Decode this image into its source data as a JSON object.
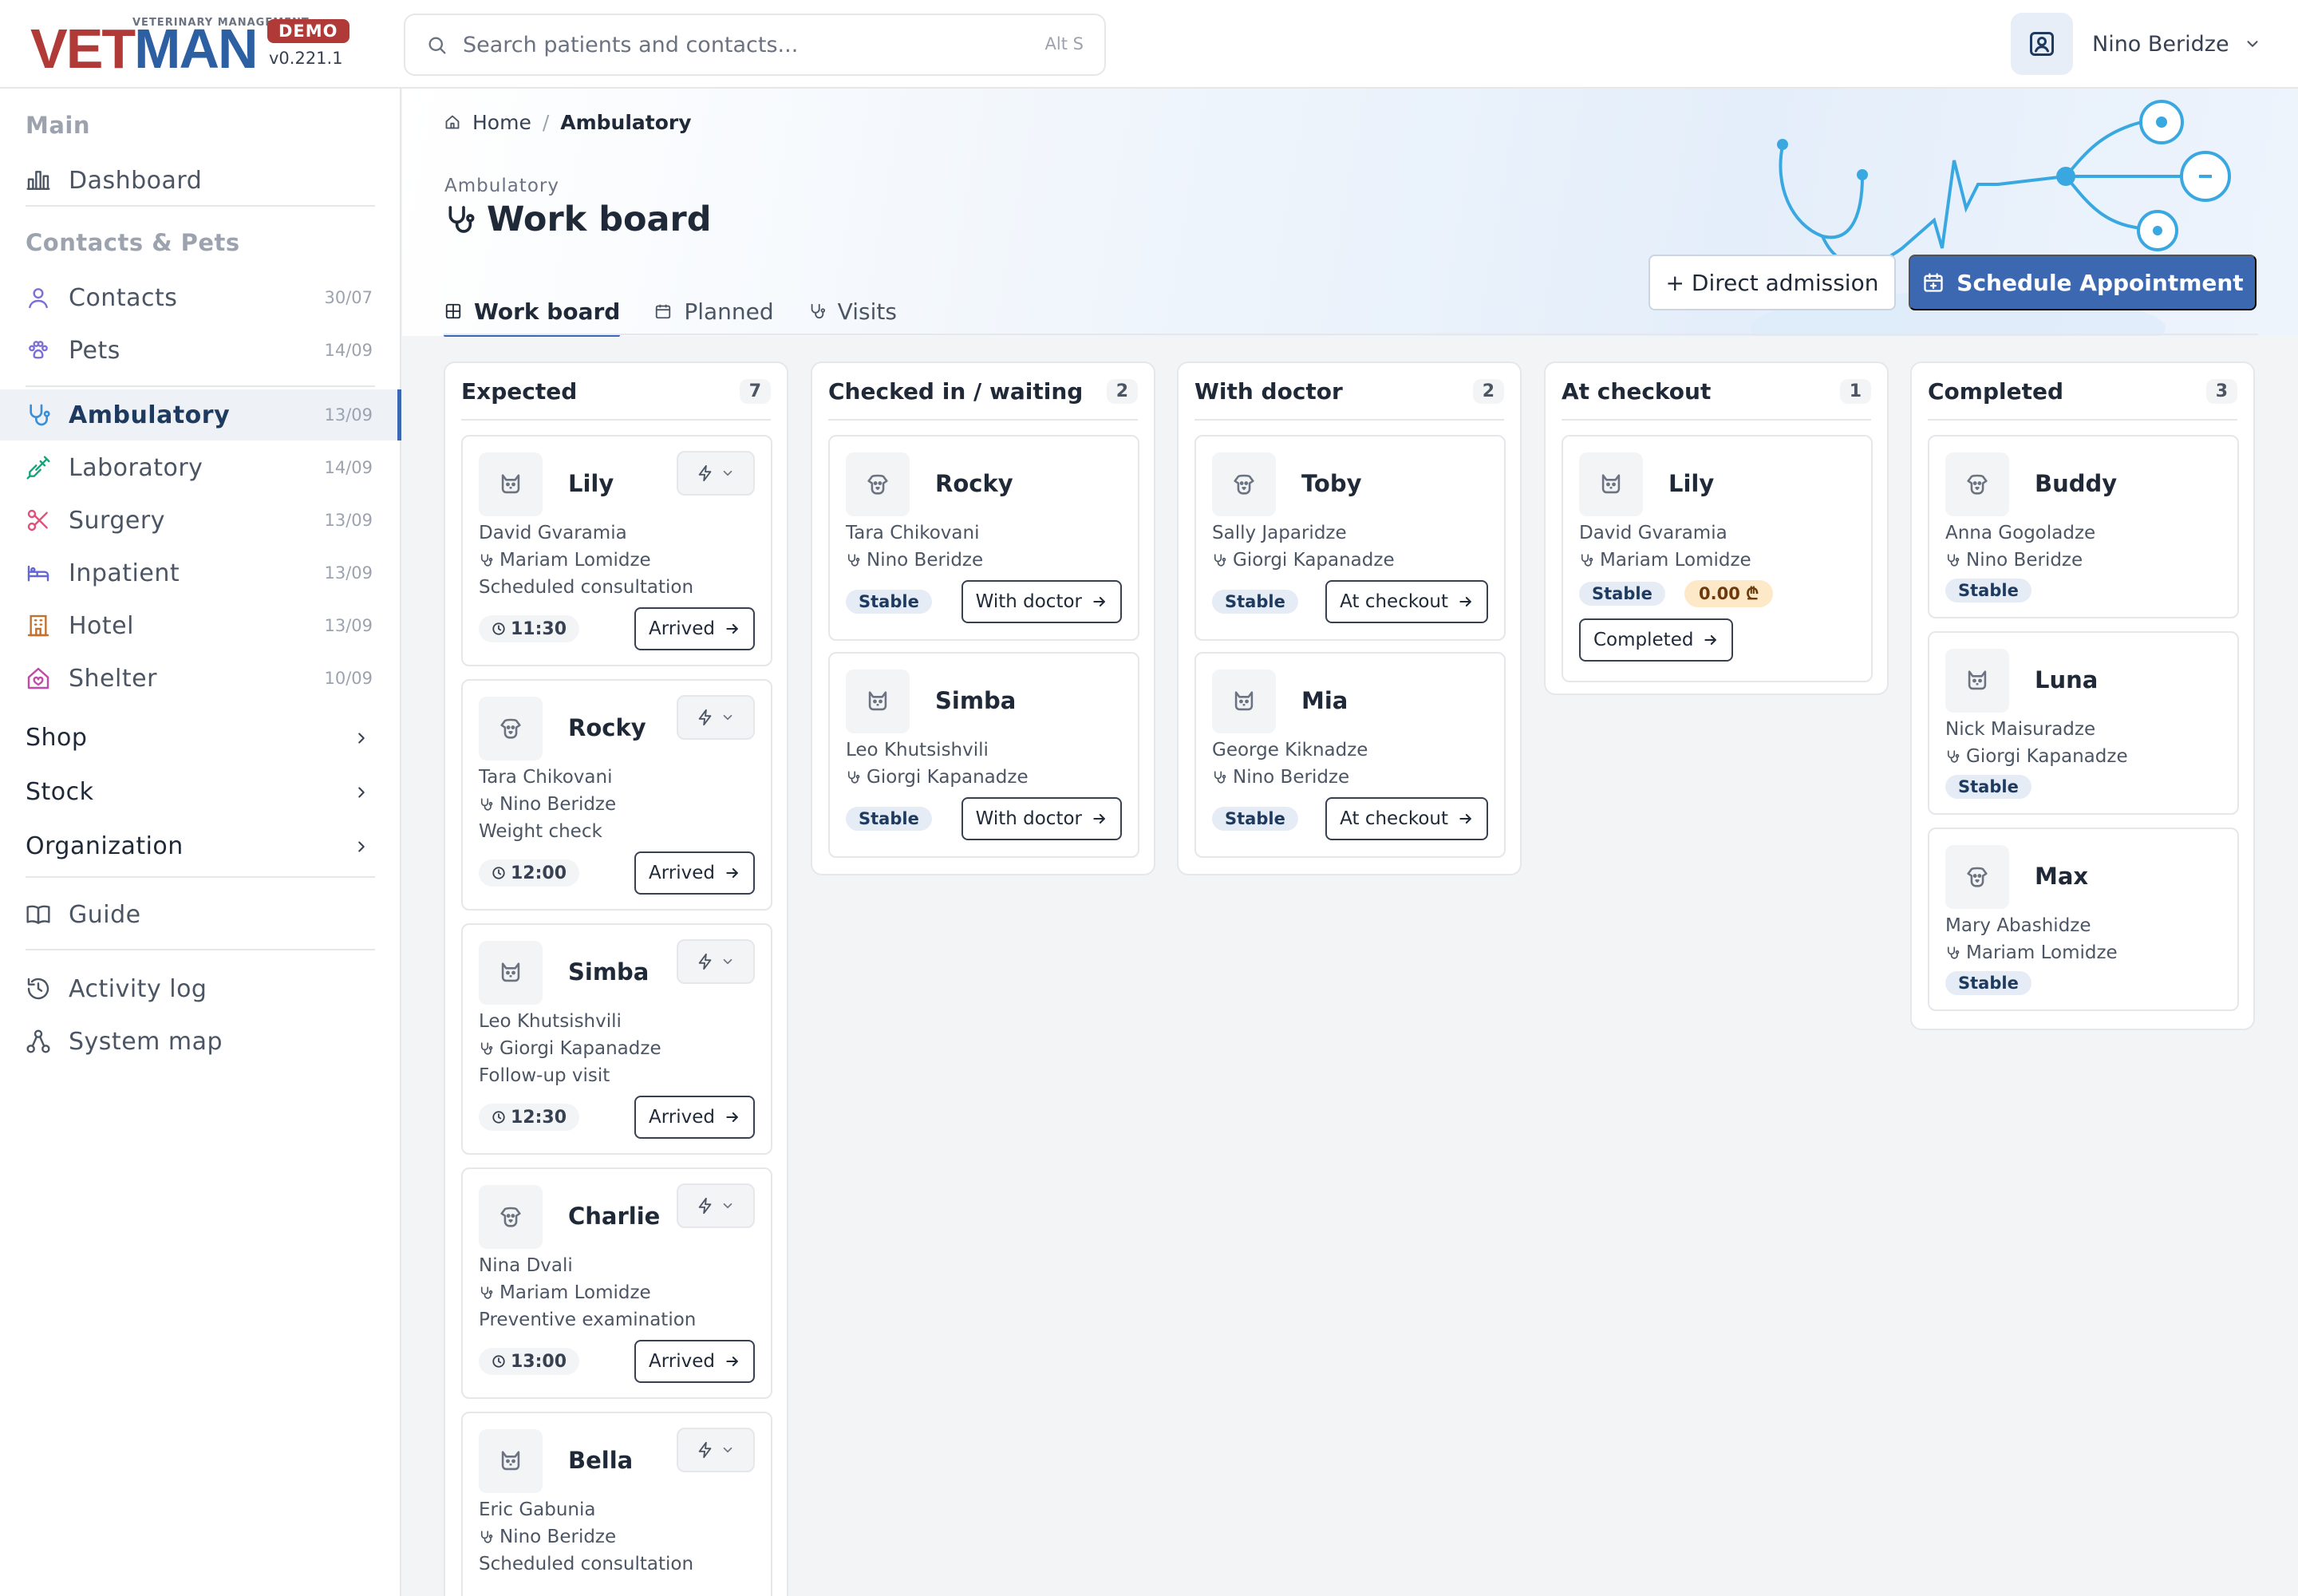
{
  "app": {
    "logo_tagline": "VETERINARY MANAGEMENT",
    "logo_text_1": "VET",
    "logo_text_2": "MAN",
    "badge": "DEMO",
    "version": "v0.221.1",
    "brand_colors": {
      "red": "#b03a37",
      "blue": "#2d5fa3"
    }
  },
  "search": {
    "placeholder": "Search patients and contacts...",
    "shortcut": "Alt S",
    "icon": "search-icon"
  },
  "user": {
    "name": "Nino Beridze",
    "icon": "user-square-icon"
  },
  "sidebar": {
    "sections": {
      "main": "Main",
      "contacts_pets": "Contacts & Pets"
    },
    "items": [
      {
        "label": "Dashboard",
        "icon": "chart-bar-icon",
        "count": ""
      },
      {
        "label": "Contacts",
        "icon": "person-icon",
        "count": "30/07"
      },
      {
        "label": "Pets",
        "icon": "paw-icon",
        "count": "14/09"
      },
      {
        "label": "Ambulatory",
        "icon": "stethoscope-icon",
        "count": "13/09",
        "active": true
      },
      {
        "label": "Laboratory",
        "icon": "syringe-icon",
        "count": "14/09"
      },
      {
        "label": "Surgery",
        "icon": "scissors-icon",
        "count": "13/09"
      },
      {
        "label": "Inpatient",
        "icon": "bed-icon",
        "count": "13/09"
      },
      {
        "label": "Hotel",
        "icon": "building-icon",
        "count": "13/09"
      },
      {
        "label": "Shelter",
        "icon": "house-heart-icon",
        "count": "10/09"
      }
    ],
    "groups": [
      {
        "label": "Shop"
      },
      {
        "label": "Stock"
      },
      {
        "label": "Organization"
      }
    ],
    "bottom": [
      {
        "label": "Guide",
        "icon": "book-icon"
      },
      {
        "label": "Activity log",
        "icon": "history-icon"
      },
      {
        "label": "System map",
        "icon": "sitemap-icon"
      }
    ]
  },
  "breadcrumb": {
    "home": "Home",
    "separator": "/",
    "current": "Ambulatory"
  },
  "page": {
    "module": "Ambulatory",
    "title": "Work board"
  },
  "tabs": [
    {
      "label": "Work board",
      "active": true
    },
    {
      "label": "Planned"
    },
    {
      "label": "Visits"
    }
  ],
  "actions": {
    "direct_admission": "+ Direct admission",
    "schedule": "Schedule Appointment"
  },
  "accent_color": "#3b68b0",
  "board": {
    "columns": [
      {
        "title": "Expected",
        "count": "7",
        "cards": [
          {
            "pet": "Lily",
            "species_icon": "cat-icon",
            "owner": "David Gvaramia",
            "doctor": "Mariam Lomidze",
            "reason": "Scheduled consultation",
            "time": "11:30",
            "action": "Arrived"
          },
          {
            "pet": "Rocky",
            "species_icon": "dog-icon",
            "owner": "Tara Chikovani",
            "doctor": "Nino Beridze",
            "reason": "Weight check",
            "time": "12:00",
            "action": "Arrived"
          },
          {
            "pet": "Simba",
            "species_icon": "cat-icon",
            "owner": "Leo Khutsishvili",
            "doctor": "Giorgi Kapanadze",
            "reason": "Follow-up visit",
            "time": "12:30",
            "action": "Arrived"
          },
          {
            "pet": "Charlie",
            "species_icon": "dog-icon",
            "owner": "Nina Dvali",
            "doctor": "Mariam Lomidze",
            "reason": "Preventive examination",
            "time": "13:00",
            "action": "Arrived"
          },
          {
            "pet": "Bella",
            "species_icon": "cat-icon",
            "owner": "Eric Gabunia",
            "doctor": "Nino Beridze",
            "reason": "Scheduled consultation",
            "time": "",
            "action": ""
          }
        ]
      },
      {
        "title": "Checked in / waiting",
        "count": "2",
        "cards": [
          {
            "pet": "Rocky",
            "species_icon": "dog-icon",
            "owner": "Tara Chikovani",
            "doctor": "Nino Beridze",
            "status": "Stable",
            "action": "With doctor"
          },
          {
            "pet": "Simba",
            "species_icon": "cat-icon",
            "owner": "Leo Khutsishvili",
            "doctor": "Giorgi Kapanadze",
            "status": "Stable",
            "action": "With doctor"
          }
        ]
      },
      {
        "title": "With doctor",
        "count": "2",
        "cards": [
          {
            "pet": "Toby",
            "species_icon": "dog-icon",
            "owner": "Sally Japaridze",
            "doctor": "Giorgi Kapanadze",
            "status": "Stable",
            "action": "At checkout"
          },
          {
            "pet": "Mia",
            "species_icon": "cat-icon",
            "owner": "George Kiknadze",
            "doctor": "Nino Beridze",
            "status": "Stable",
            "action": "At checkout"
          }
        ]
      },
      {
        "title": "At checkout",
        "count": "1",
        "cards": [
          {
            "pet": "Lily",
            "species_icon": "cat-icon",
            "owner": "David Gvaramia",
            "doctor": "Mariam Lomidze",
            "status": "Stable",
            "balance": "0.00 ₾",
            "action": "Completed"
          }
        ]
      },
      {
        "title": "Completed",
        "count": "3",
        "cards": [
          {
            "pet": "Buddy",
            "species_icon": "dog-icon",
            "owner": "Anna Gogoladze",
            "doctor": "Nino Beridze",
            "status": "Stable"
          },
          {
            "pet": "Luna",
            "species_icon": "cat-icon",
            "owner": "Nick Maisuradze",
            "doctor": "Giorgi Kapanadze",
            "status": "Stable"
          },
          {
            "pet": "Max",
            "species_icon": "dog-icon",
            "owner": "Mary Abashidze",
            "doctor": "Mariam Lomidze",
            "status": "Stable"
          }
        ]
      }
    ]
  }
}
